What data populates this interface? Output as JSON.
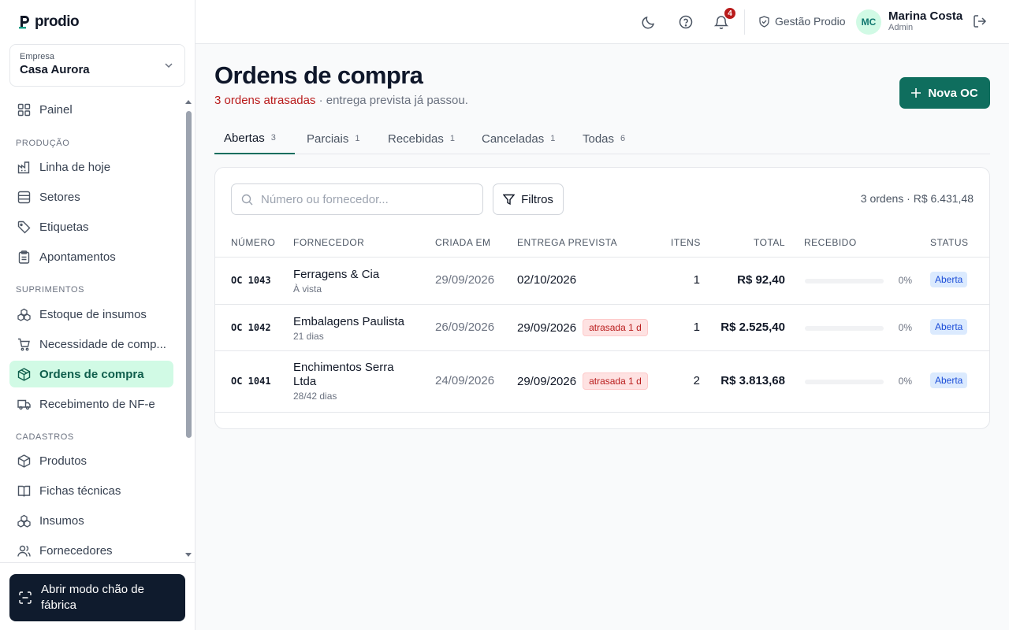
{
  "brand": {
    "name": "prodio",
    "accent": "#0f6e5e"
  },
  "company_selector": {
    "label": "Empresa",
    "value": "Casa Aurora"
  },
  "sidebar": {
    "items": [
      {
        "label": "Painel",
        "icon": "grid-icon"
      },
      {
        "label": "Linha de hoje",
        "icon": "factory-icon"
      },
      {
        "label": "Setores",
        "icon": "list-icon"
      },
      {
        "label": "Etiquetas",
        "icon": "tag-icon"
      },
      {
        "label": "Apontamentos",
        "icon": "clipboard-icon"
      },
      {
        "label": "Estoque de insumos",
        "icon": "boxes-icon"
      },
      {
        "label": "Necessidade de comp...",
        "icon": "cart-icon"
      },
      {
        "label": "Ordens de compra",
        "icon": "package-icon"
      },
      {
        "label": "Recebimento de NF-e",
        "icon": "truck-icon"
      },
      {
        "label": "Produtos",
        "icon": "package-icon"
      },
      {
        "label": "Fichas técnicas",
        "icon": "book-icon"
      },
      {
        "label": "Insumos",
        "icon": "boxes-icon"
      },
      {
        "label": "Fornecedores",
        "icon": "users-icon"
      }
    ],
    "sections": [
      "PRODUÇÃO",
      "SUPRIMENTOS",
      "CADASTROS"
    ],
    "floor_mode_button": "Abrir modo chão de fábrica"
  },
  "header": {
    "notification_count": "4",
    "tenant": "Gestão Prodio",
    "user_initials": "MC",
    "user_name": "Marina Costa",
    "user_role": "Admin"
  },
  "page": {
    "title": "Ordens de compra",
    "late_text": "3 ordens atrasadas",
    "late_suffix": " · entrega prevista já passou.",
    "new_button": "Nova OC"
  },
  "tabs": [
    {
      "label": "Abertas",
      "count": "3"
    },
    {
      "label": "Parciais",
      "count": "1"
    },
    {
      "label": "Recebidas",
      "count": "1"
    },
    {
      "label": "Canceladas",
      "count": "1"
    },
    {
      "label": "Todas",
      "count": "6"
    }
  ],
  "toolbar": {
    "search_placeholder": "Número ou fornecedor...",
    "filters_label": "Filtros",
    "summary": "3 ordens · R$ 6.431,48"
  },
  "table": {
    "columns": [
      "NÚMERO",
      "FORNECEDOR",
      "CRIADA EM",
      "ENTREGA PREVISTA",
      "ITENS",
      "TOTAL",
      "RECEBIDO",
      "STATUS"
    ],
    "rows": [
      {
        "number": "OC 1043",
        "supplier": "Ferragens & Cia",
        "terms": "À vista",
        "created": "29/09/2026",
        "due": "02/10/2026",
        "late": "",
        "items": "1",
        "total": "R$ 92,40",
        "received_pct": "0%",
        "received_fraction": 0,
        "status": "Aberta"
      },
      {
        "number": "OC 1042",
        "supplier": "Embalagens Paulista",
        "terms": "21 dias",
        "created": "26/09/2026",
        "due": "29/09/2026",
        "late": "atrasada 1 d",
        "items": "1",
        "total": "R$ 2.525,40",
        "received_pct": "0%",
        "received_fraction": 0,
        "status": "Aberta"
      },
      {
        "number": "OC 1041",
        "supplier": "Enchimentos Serra Ltda",
        "terms": "28/42 dias",
        "created": "24/09/2026",
        "due": "29/09/2026",
        "late": "atrasada 1 d",
        "items": "2",
        "total": "R$ 3.813,68",
        "received_pct": "0%",
        "received_fraction": 0,
        "status": "Aberta"
      }
    ]
  }
}
